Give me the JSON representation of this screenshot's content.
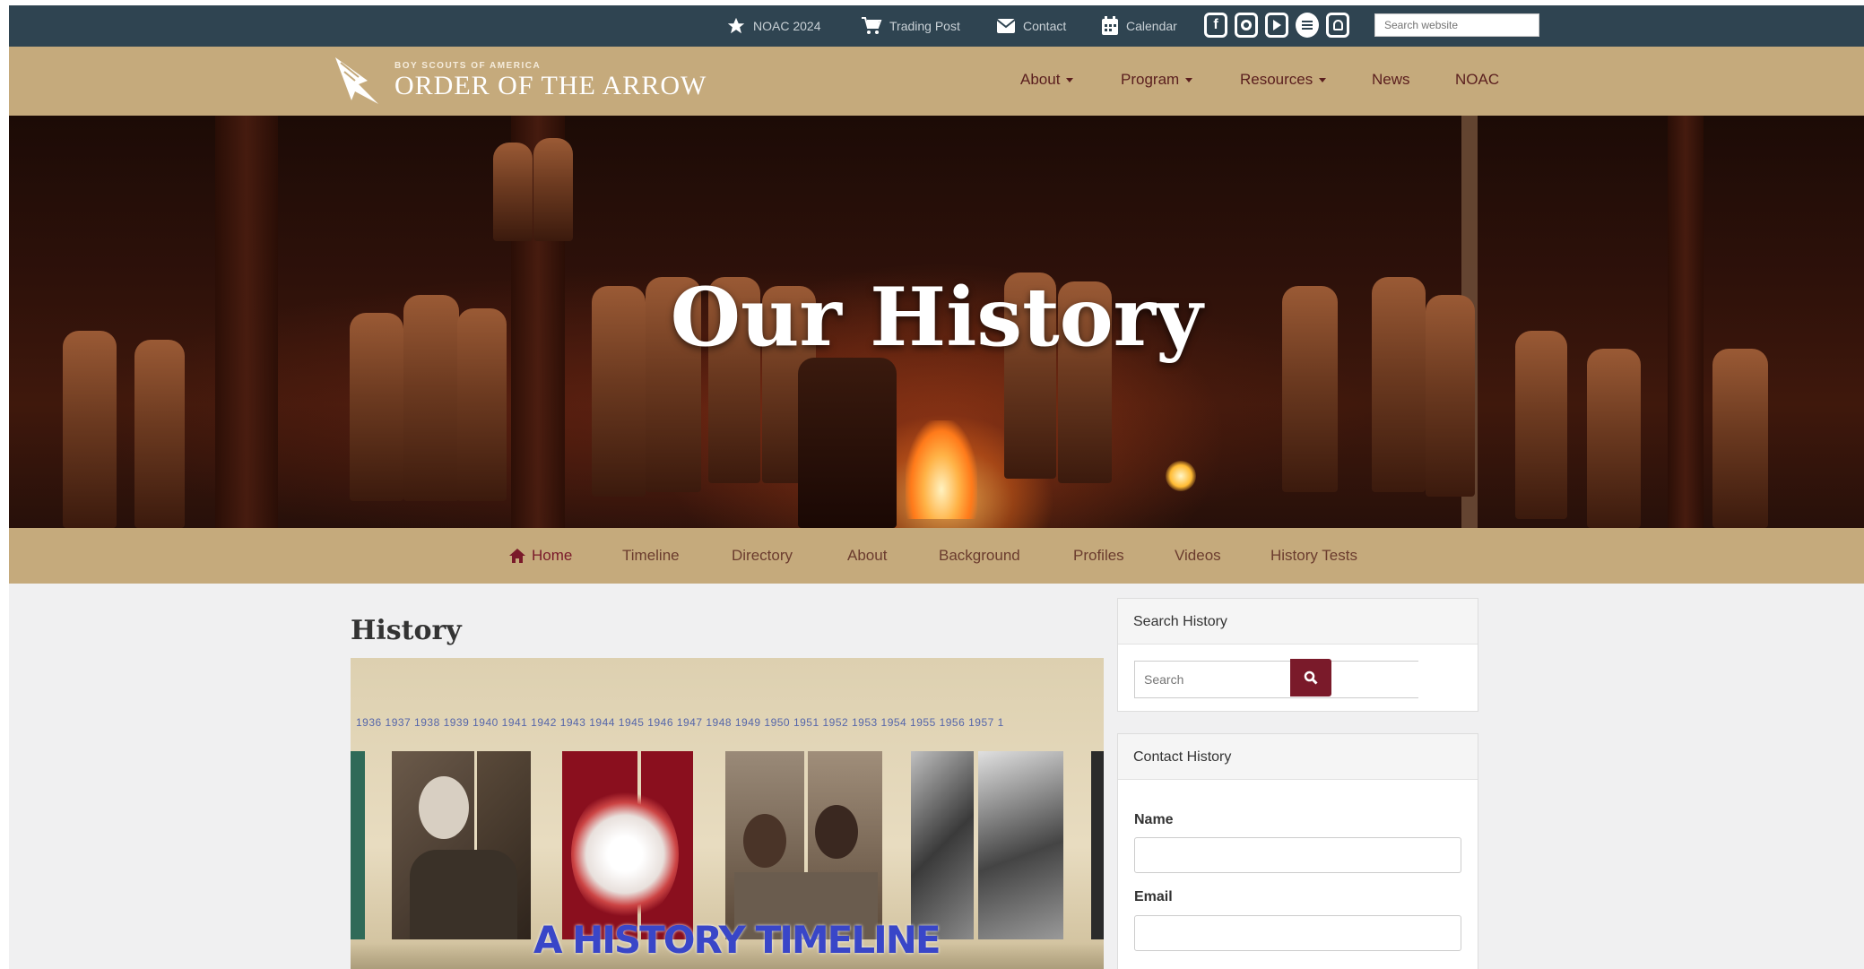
{
  "topbar": {
    "items": [
      {
        "label": "NOAC 2024",
        "icon": "star-icon"
      },
      {
        "label": "Trading Post",
        "icon": "cart-icon"
      },
      {
        "label": "Contact",
        "icon": "envelope-icon"
      },
      {
        "label": "Calendar",
        "icon": "calendar-icon"
      }
    ],
    "social_icons": [
      "facebook-icon",
      "instagram-icon",
      "youtube-icon",
      "spotify-icon",
      "snapchat-icon"
    ],
    "search_placeholder": "Search website"
  },
  "brand": {
    "small": "BOY SCOUTS OF AMERICA",
    "name": "ORDER OF THE ARROW"
  },
  "nav": [
    {
      "label": "About",
      "dropdown": true
    },
    {
      "label": "Program",
      "dropdown": true
    },
    {
      "label": "Resources",
      "dropdown": true
    },
    {
      "label": "News",
      "dropdown": false
    },
    {
      "label": "NOAC",
      "dropdown": false
    }
  ],
  "hero": {
    "title": "Our History"
  },
  "subnav": [
    "Home",
    "Timeline",
    "Directory",
    "About",
    "Background",
    "Profiles",
    "Videos",
    "History Tests"
  ],
  "main": {
    "title": "History",
    "timeline_years": "1936  1937  1938  1939  1940  1941  1942  1943  1944  1945  1946  1947  1948  1949  1950  1951  1952  1953  1954  1955  1956  1957  1",
    "timeline_caption": "A HISTORY TIMELINE"
  },
  "sidebar": {
    "search": {
      "title": "Search History",
      "placeholder": "Search"
    },
    "contact": {
      "title": "Contact History",
      "name_label": "Name",
      "email_label": "Email"
    }
  },
  "colors": {
    "topbar": "#2f4451",
    "brand_tan": "#c5aa7c",
    "accent_maroon": "#7a1a2a",
    "caption_blue": "#3946c8"
  }
}
